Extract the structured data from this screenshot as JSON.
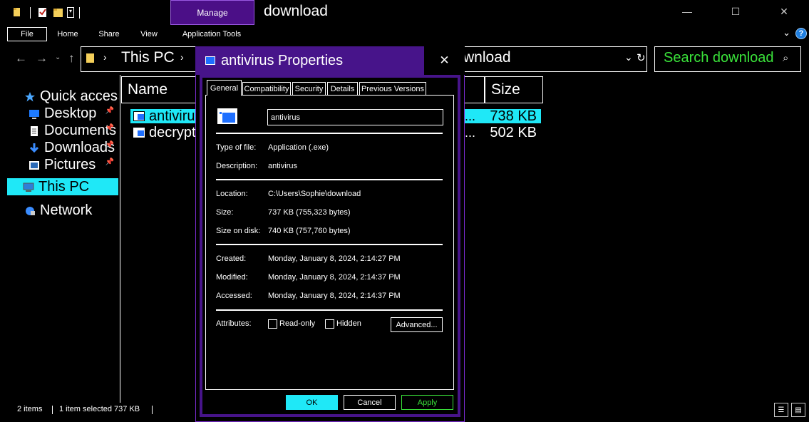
{
  "window": {
    "title": "download",
    "manage_tab": "Manage",
    "controls": {
      "minimize": "—",
      "maximize": "☐",
      "close": "✕"
    }
  },
  "ribbon": {
    "tabs": [
      "File",
      "Home",
      "Share",
      "View",
      "Application Tools"
    ],
    "help": "?"
  },
  "address": {
    "segments": [
      "This PC",
      "›"
    ],
    "current": "download",
    "search_placeholder": "Search download"
  },
  "nav": {
    "items": [
      {
        "label": "Quick access",
        "icon": "star-icon",
        "pinned": false
      },
      {
        "label": "Desktop",
        "icon": "desktop-icon",
        "pinned": true
      },
      {
        "label": "Documents",
        "icon": "documents-icon",
        "pinned": true
      },
      {
        "label": "Downloads",
        "icon": "downloads-icon",
        "pinned": true
      },
      {
        "label": "Pictures",
        "icon": "pictures-icon",
        "pinned": true
      },
      {
        "label": "This PC",
        "icon": "this-pc-icon",
        "pinned": false,
        "selected": true
      },
      {
        "label": "Network",
        "icon": "network-icon",
        "pinned": false
      }
    ]
  },
  "file_list": {
    "columns": [
      "Name",
      "Size"
    ],
    "rows": [
      {
        "name": "antivirus",
        "size": "738 KB",
        "selected": true
      },
      {
        "name": "decrypt",
        "size": "502 KB",
        "selected": false
      }
    ]
  },
  "status_bar": {
    "count": "2 items",
    "selection": "1 item selected  737 KB"
  },
  "dialog": {
    "title": "antivirus Properties",
    "close": "✕",
    "tabs": [
      "General",
      "Compatibility",
      "Security",
      "Details",
      "Previous Versions"
    ],
    "name_value": "antivirus",
    "fields": {
      "type_label": "Type of file:",
      "type_value": "Application (.exe)",
      "desc_label": "Description:",
      "desc_value": "antivirus",
      "location_label": "Location:",
      "location_value": "C:\\Users\\Sophie\\download",
      "size_label": "Size:",
      "size_value": "737 KB (755,323 bytes)",
      "disk_label": "Size on disk:",
      "disk_value": "740 KB (757,760 bytes)",
      "created_label": "Created:",
      "created_value": "Monday, January 8, 2024, 2:14:27 PM",
      "modified_label": "Modified:",
      "modified_value": "Monday, January 8, 2024, 2:14:37 PM",
      "accessed_label": "Accessed:",
      "accessed_value": "Monday, January 8, 2024, 2:14:37 PM",
      "attributes_label": "Attributes:"
    },
    "attributes": {
      "readonly": "Read-only",
      "hidden": "Hidden",
      "advanced": "Advanced..."
    },
    "buttons": {
      "ok": "OK",
      "cancel": "Cancel",
      "apply": "Apply"
    }
  },
  "colors": {
    "highlight": "#1fe8f7",
    "dialog_purple": "#47148a",
    "search_green": "#3ae33a",
    "apply_green": "#3ae33a"
  }
}
